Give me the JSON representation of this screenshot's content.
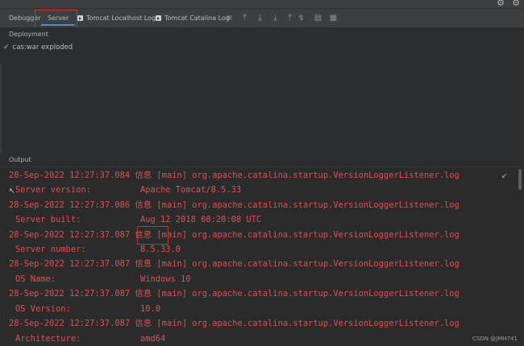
{
  "toolbar_icons": [
    "gear-icon",
    "settings-icon"
  ],
  "tabs": [
    {
      "label": "Debugger",
      "active": false,
      "icon": false
    },
    {
      "label": "Server",
      "active": true,
      "icon": false
    },
    {
      "label": "Tomcat Localhost Log",
      "active": false,
      "icon": true
    },
    {
      "label": "Tomcat Catalina Log",
      "active": false,
      "icon": true
    }
  ],
  "tool_icons": [
    "menu-icon",
    "scroll-up-icon",
    "download-icon",
    "download-icon",
    "upload-icon",
    "filter-icon",
    "list-icon",
    "grid-icon"
  ],
  "deployment": {
    "header": "Deployment",
    "items": [
      {
        "label": "cas:war exploded",
        "status": "ok"
      }
    ]
  },
  "output": {
    "header": "Output",
    "lines": [
      {
        "text": "28-Sep-2022 12:27:37.084 信息 [main] org.apache.catalina.startup.VersionLoggerListener.log",
        "indent": false
      },
      {
        "key": "Server version:",
        "value": "Apache Tomcat/8.5.33",
        "indent": true
      },
      {
        "text": "28-Sep-2022 12:27:37.086 信息 [main] org.apache.catalina.startup.VersionLoggerListener.log",
        "indent": false
      },
      {
        "key": "Server built:",
        "value": "Aug 12 2018 08:20:08 UTC",
        "indent": true
      },
      {
        "text": "28-Sep-2022 12:27:37.087 信息 [main] org.apache.catalina.startup.VersionLoggerListener.log",
        "indent": false
      },
      {
        "key": "Server number:",
        "value": "8.5.33.0",
        "indent": true
      },
      {
        "text": "28-Sep-2022 12:27:37.087 信息 [main] org.apache.catalina.startup.VersionLoggerListener.log",
        "indent": false
      },
      {
        "key": "OS Name:",
        "value": "Windows 10",
        "indent": true
      },
      {
        "text": "28-Sep-2022 12:27:37.087 信息 [main] org.apache.catalina.startup.VersionLoggerListener.log",
        "indent": false
      },
      {
        "key": "OS Version:",
        "value": "10.0",
        "indent": true
      },
      {
        "text": "28-Sep-2022 12:27:37.087 信息 [main] org.apache.catalina.startup.VersionLoggerListener.log",
        "indent": false
      },
      {
        "key": "Architecture:",
        "value": "amd64",
        "indent": true
      }
    ]
  },
  "watermark": "CSDN @JMH741",
  "colors": {
    "log_text": "#e05050",
    "highlight_box": "#c9302c",
    "active_tab_underline": "#4a88c7",
    "status_ok": "#59a869"
  }
}
